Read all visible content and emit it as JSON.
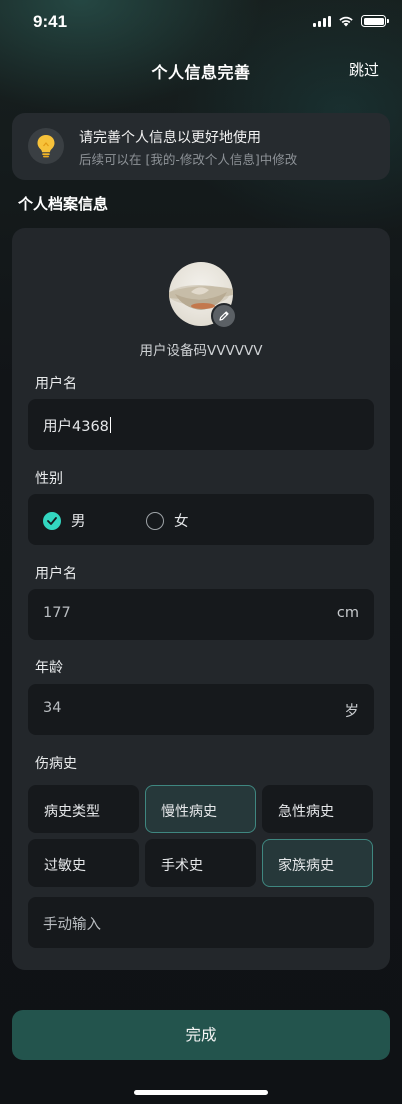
{
  "status_bar": {
    "time": "9:41"
  },
  "nav": {
    "title": "个人信息完善",
    "skip_label": "跳过"
  },
  "tip": {
    "title": "请完善个人信息以更好地使用",
    "subtitle": "后续可以在 [我的-修改个人信息]中修改",
    "icon": "lightbulb-icon"
  },
  "section_title": "个人档案信息",
  "profile": {
    "device_code": "用户设备码VVVVVV",
    "edit_icon": "pencil-icon"
  },
  "fields": {
    "username": {
      "label": "用户名",
      "value": "用户4368"
    },
    "gender": {
      "label": "性别",
      "options": [
        {
          "label": "男",
          "checked": true
        },
        {
          "label": "女",
          "checked": false
        }
      ]
    },
    "height": {
      "label": "用户名",
      "value": "177",
      "unit": "cm"
    },
    "age": {
      "label": "年龄",
      "value": "34",
      "unit": "岁"
    },
    "history": {
      "label": "伤病史",
      "tags": [
        {
          "label": "病史类型",
          "selected": false
        },
        {
          "label": "慢性病史",
          "selected": true
        },
        {
          "label": "急性病史",
          "selected": false
        },
        {
          "label": "过敏史",
          "selected": false
        },
        {
          "label": "手术史",
          "selected": false
        },
        {
          "label": "家族病史",
          "selected": true
        }
      ],
      "manual_placeholder": "手动输入"
    }
  },
  "done_label": "完成",
  "colors": {
    "accent": "#33d6c0",
    "button": "#23544d",
    "card": "#23272b"
  }
}
